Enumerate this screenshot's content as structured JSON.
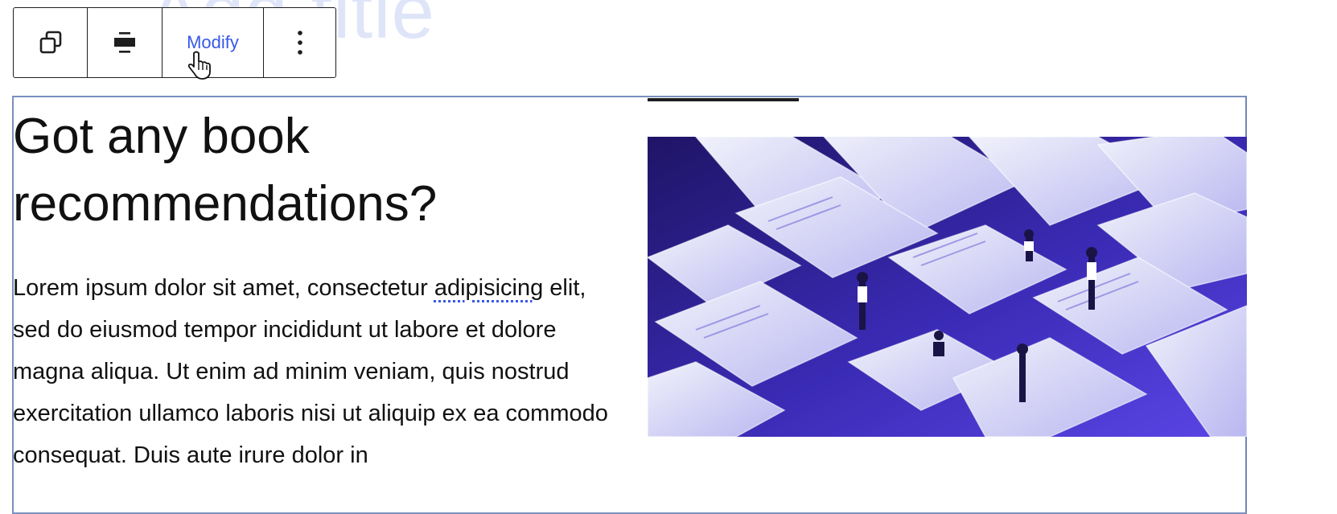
{
  "page": {
    "ghost_title": "Add title"
  },
  "toolbar": {
    "duplicate_icon": "duplicate-icon",
    "align_icon": "align-center-icon",
    "modify_label": "Modify",
    "more_icon": "more-vertical-icon",
    "accent_color": "#3858e9"
  },
  "block": {
    "heading": "Got any book recommendations?",
    "paragraph_before": "Lorem ipsum dolor sit amet, consectetur ",
    "paragraph_flagged_word": "adipisicing",
    "paragraph_after": " elit, sed do eiusmod tempor incididunt ut labore et dolore magna aliqua. Ut enim ad minim veniam, quis nostrud exercitation ullamco laboris nisi ut aliquip ex ea commodo consequat. Duis aute irure dolor in"
  },
  "media": {
    "image_colors": {
      "dark": "#1f1466",
      "mid": "#5b45e6",
      "light": "#e7e9f8"
    }
  }
}
